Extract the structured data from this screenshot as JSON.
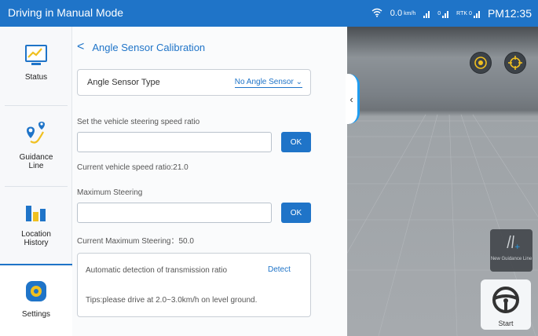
{
  "statusbar": {
    "title": "Driving in Manual Mode",
    "speed_value": "0.0",
    "speed_unit": "km/h",
    "sat_count": "0",
    "rtk_label": "RTK",
    "rtk_count": "0",
    "time": "PM12:35"
  },
  "sidebar": {
    "items": [
      {
        "label": "Status",
        "icon": "chart-icon"
      },
      {
        "label": "Guidance Line",
        "icon": "route-pin-icon"
      },
      {
        "label": "Location History",
        "icon": "bar-chart-icon"
      },
      {
        "label": "Settings",
        "icon": "gear-icon"
      }
    ],
    "active_color": "#1f74c8"
  },
  "page": {
    "back": "<",
    "title": "Angle Sensor Calibration"
  },
  "angle_sensor": {
    "label": "Angle Sensor Type",
    "selected": "No Angle Sensor"
  },
  "steering_ratio": {
    "label": "Set the vehicle steering speed ratio",
    "value": "",
    "ok_label": "OK",
    "current": "Current vehicle speed ratio:21.0"
  },
  "max_steering": {
    "label": "Maximum Steering",
    "value": "",
    "ok_label": "OK",
    "current": "Current Maximum Steering：50.0"
  },
  "detection": {
    "label": "Automatic detection of transmission ratio",
    "detect_label": "Detect",
    "tip": "Tips:please drive at 2.0~3.0km/h on level ground."
  },
  "view": {
    "new_guidance_label": "New Guidance Line",
    "start_label": "Start"
  },
  "colors": {
    "brand": "#1f74c8",
    "accent_tab": "#1f9cf0",
    "status_bar": "#1f74c8",
    "icon_yellow": "#f0c020"
  }
}
